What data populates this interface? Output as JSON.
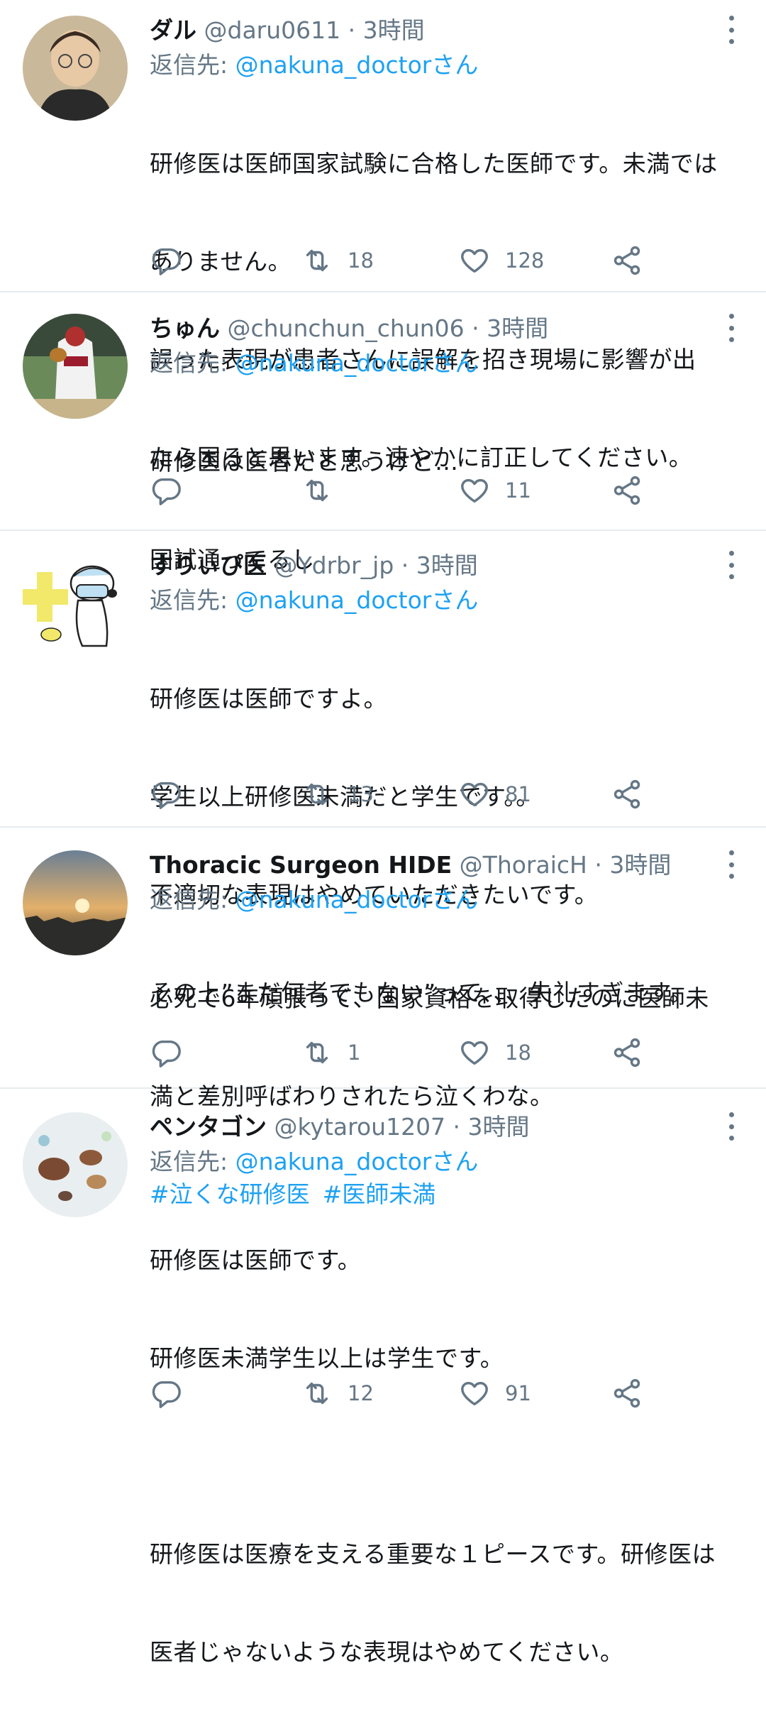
{
  "tweets": [
    {
      "name": "ダル",
      "handle": "@daru0611",
      "sep": " · ",
      "time": "3時間",
      "reply_prefix": "返信先: ",
      "reply_to": "@nakuna_doctorさん",
      "body": "研修医は医師国家試験に合格した医師です。未満ではありません。\n誤った表現が患者さんに誤解を招き現場に影響が出たら困ると思います。速やかに訂正してください。",
      "body_lines": [
        "研修医は医師国家試験に合格した医師です。未満では",
        "ありません。",
        "誤った表現が患者さんに誤解を招き現場に影響が出",
        "たら困ると思います。速やかに訂正してください。"
      ],
      "retweets": "18",
      "likes": "128",
      "avatar_icon": "portrait-avatar"
    },
    {
      "name": "ちゅん",
      "handle": "@chunchun_chun06",
      "sep": " · ",
      "time": "3時間",
      "reply_prefix": "返信先: ",
      "reply_to": "@nakuna_doctorさん",
      "body_lines": [
        "研修医は医者だと思うけど…",
        "国試通ってるし"
      ],
      "retweets": "",
      "likes": "11",
      "avatar_icon": "baseball-player-avatar"
    },
    {
      "name": "すりぃぴ医",
      "handle": "@Ydrbr_jp",
      "sep": " · ",
      "time": "3時間",
      "reply_prefix": "返信先: ",
      "reply_to": "@nakuna_doctorさん",
      "body_lines": [
        "研修医は医師ですよ。",
        "学生以上研修医未満だと学生です。。",
        "不適切な表現はやめていただきたいです。",
        "その上”まだ何者でもない”って、、、失礼すぎます。"
      ],
      "retweets": "13",
      "likes": "81",
      "avatar_icon": "snoopy-doctor-avatar"
    },
    {
      "name": "Thoracic Surgeon HIDE",
      "handle": "@ThoraicH",
      "sep": " · ",
      "time": "3時間",
      "reply_prefix": "返信先: ",
      "reply_to": "@nakuna_doctorさん",
      "body_lines": [
        "必死で6年頑張って、国家資格を取得したのに医師未",
        "満と差別呼ばわりされたら泣くわな。"
      ],
      "hashtags": [
        "#泣くな研修医",
        "#医師未満"
      ],
      "retweets": "1",
      "likes": "18",
      "avatar_icon": "sunset-city-avatar"
    },
    {
      "name": "ペンタゴン",
      "handle": "@kytarou1207",
      "sep": " · ",
      "time": "3時間",
      "reply_prefix": "返信先: ",
      "reply_to": "@nakuna_doctorさん",
      "body_lines": [
        "研修医は医師です。",
        "研修医未満学生以上は学生です。",
        "",
        "研修医は医療を支える重要な１ピースです。研修医は",
        "医者じゃないような表現はやめてください。"
      ],
      "retweets": "12",
      "likes": "91",
      "avatar_icon": "animal-illustration-avatar"
    }
  ]
}
